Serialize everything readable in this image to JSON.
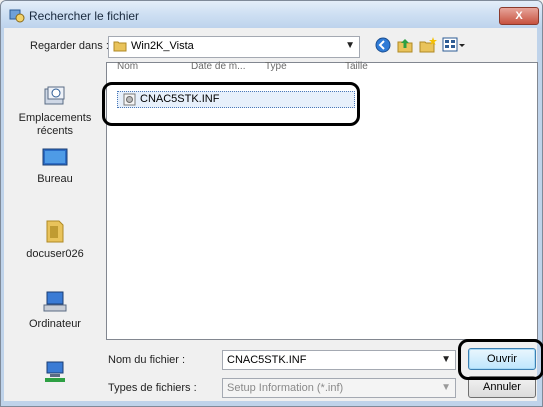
{
  "window": {
    "title": "Rechercher le fichier",
    "close_label": "X"
  },
  "lookin": {
    "label": "Regarder dans :",
    "value": "Win2K_Vista"
  },
  "columns": [
    "Nom",
    "Date de m...",
    "Type",
    "Taille"
  ],
  "places": [
    {
      "label": "Emplacements récents",
      "icon": "recent-places-icon"
    },
    {
      "label": "Bureau",
      "icon": "desktop-icon"
    },
    {
      "label": "docuser026",
      "icon": "user-folder-icon"
    },
    {
      "label": "Ordinateur",
      "icon": "computer-icon"
    },
    {
      "label": "",
      "icon": "network-icon"
    }
  ],
  "files": [
    {
      "name": "CNAC5STK.INF",
      "selected": true
    }
  ],
  "filename": {
    "label": "Nom du fichier :",
    "value": "CNAC5STK.INF"
  },
  "filetype": {
    "label": "Types de fichiers :",
    "value": "Setup Information (*.inf)"
  },
  "buttons": {
    "open": "Ouvrir",
    "cancel": "Annuler"
  },
  "colors": {
    "accent": "#4a78b8",
    "highlight": "#000000"
  }
}
